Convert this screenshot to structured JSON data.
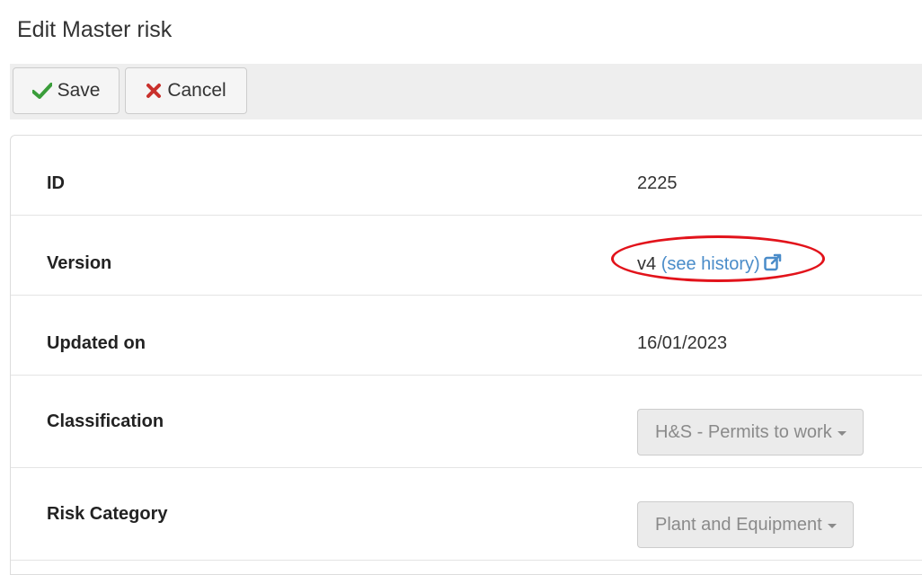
{
  "page": {
    "title": "Edit Master risk"
  },
  "toolbar": {
    "save_label": "Save",
    "cancel_label": "Cancel"
  },
  "fields": {
    "id": {
      "label": "ID",
      "value": "2225"
    },
    "version": {
      "label": "Version",
      "value": "v4",
      "history_link": "(see history)"
    },
    "updated_on": {
      "label": "Updated on",
      "value": "16/01/2023"
    },
    "classification": {
      "label": "Classification",
      "selected": "H&S - Permits to work"
    },
    "risk_category": {
      "label": "Risk Category",
      "selected": "Plant and Equipment"
    }
  },
  "colors": {
    "save_icon": "#3a9d3a",
    "cancel_icon": "#c9302c",
    "link": "#4a8cc9",
    "annotation": "#e2131b"
  },
  "icons": {
    "save": "check-icon",
    "cancel": "x-icon",
    "history": "external-link-icon"
  }
}
